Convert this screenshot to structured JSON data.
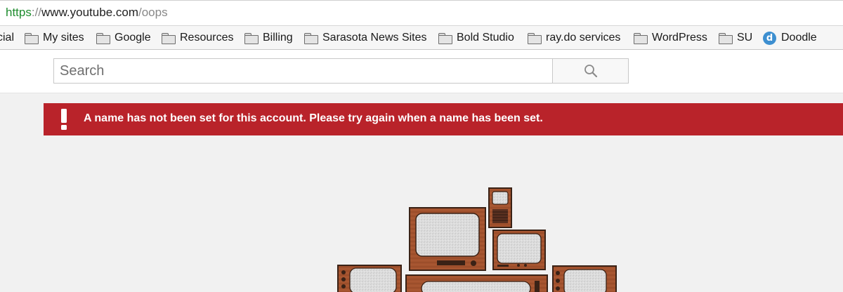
{
  "browser": {
    "url": {
      "scheme": "https",
      "separator": "://",
      "host": "www.youtube.com",
      "path": "/oops"
    },
    "bookmarks": [
      {
        "label": "cial",
        "icon": "none"
      },
      {
        "label": "My sites",
        "icon": "folder-icon"
      },
      {
        "label": "Google",
        "icon": "folder-icon"
      },
      {
        "label": "Resources",
        "icon": "folder-icon"
      },
      {
        "label": "Billing",
        "icon": "folder-icon"
      },
      {
        "label": "Sarasota News Sites",
        "icon": "folder-icon"
      },
      {
        "label": "Bold Studio",
        "icon": "folder-icon"
      },
      {
        "label": "ray.do services",
        "icon": "folder-icon"
      },
      {
        "label": "WordPress",
        "icon": "folder-icon"
      },
      {
        "label": "SU",
        "icon": "folder-icon"
      },
      {
        "label": "Doodle",
        "icon": "doodle-icon",
        "icon_letter": "d"
      }
    ]
  },
  "header": {
    "search_placeholder": "Search",
    "search_icon": "search-icon"
  },
  "alert": {
    "icon": "exclamation-icon",
    "message": "A name has not been set for this account. Please try again when a name has been set.",
    "color": "#b9232a"
  },
  "illustration": {
    "icon": "stacked-tv-illustration"
  },
  "colors": {
    "page_background": "#f1f1f1",
    "alert_background": "#b9232a",
    "url_scheme": "#1e8c2e",
    "tv_wood": "#a0522d"
  }
}
